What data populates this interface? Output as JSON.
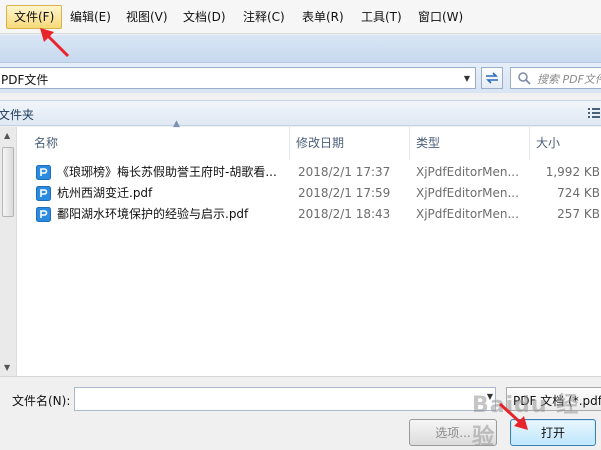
{
  "menu": {
    "items": [
      {
        "label": "文件(F)"
      },
      {
        "label": "编辑(E)"
      },
      {
        "label": "视图(V)"
      },
      {
        "label": "文档(D)"
      },
      {
        "label": "注释(C)"
      },
      {
        "label": "表单(R)"
      },
      {
        "label": "工具(T)"
      },
      {
        "label": "窗口(W)"
      }
    ]
  },
  "address": {
    "path": "PDF文件",
    "search_placeholder": "搜索 PDF文件"
  },
  "folder": {
    "label": "文件夹"
  },
  "list": {
    "columns": [
      "名称",
      "修改日期",
      "类型",
      "大小"
    ],
    "rows": [
      {
        "name": "《琅琊榜》梅长苏假助誉王府时-胡歌看...",
        "date": "2018/2/1 17:37",
        "type": "XjPdfEditorMen...",
        "size": "1,992 KB"
      },
      {
        "name": "杭州西湖变迁.pdf",
        "date": "2018/2/1 17:59",
        "type": "XjPdfEditorMen...",
        "size": "724 KB"
      },
      {
        "name": "鄱阳湖水环境保护的经验与启示.pdf",
        "date": "2018/2/1 18:43",
        "type": "XjPdfEditorMen...",
        "size": "257 KB"
      }
    ]
  },
  "bottom": {
    "filename_label": "文件名(N):",
    "filename_value": "",
    "filter": "PDF 文档 (*.pdf)",
    "options_label": "选项...",
    "open_label": "打开"
  },
  "colors": {
    "annotation": "#e8232a",
    "menu_active": "#f7d978",
    "open_button": "#bee6fd"
  },
  "watermark": "Baidu 经验"
}
